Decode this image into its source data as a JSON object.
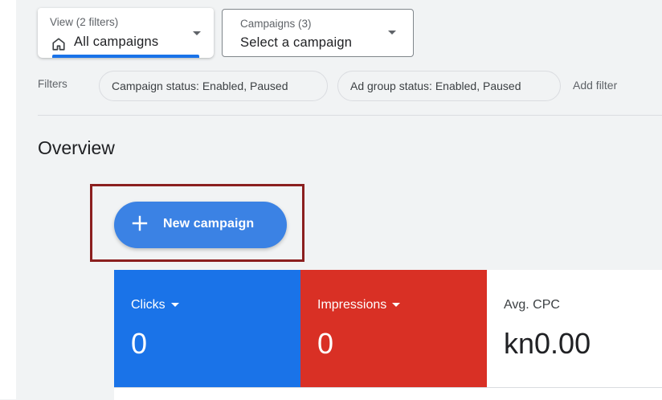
{
  "view_selector": {
    "label": "View (2 filters)",
    "value": "All campaigns",
    "icon": "home-icon"
  },
  "campaigns_selector": {
    "label": "Campaigns (3)",
    "value": "Select a campaign"
  },
  "filters": {
    "label": "Filters",
    "chips": [
      "Campaign status: Enabled, Paused",
      "Ad group status: Enabled, Paused"
    ],
    "add_label": "Add filter"
  },
  "overview": {
    "title": "Overview"
  },
  "new_campaign": {
    "label": "New campaign",
    "icon": "plus-icon"
  },
  "metrics": [
    {
      "label": "Clicks",
      "value": "0",
      "color": "#1a73e8"
    },
    {
      "label": "Impressions",
      "value": "0",
      "color": "#d93025"
    },
    {
      "label": "Avg. CPC",
      "value": "kn0.00",
      "color": "#ffffff"
    }
  ],
  "colors": {
    "accent": "#1a73e8",
    "button": "#3b82e4",
    "highlight": "#8b1f1f",
    "background": "#f1f3f4"
  }
}
